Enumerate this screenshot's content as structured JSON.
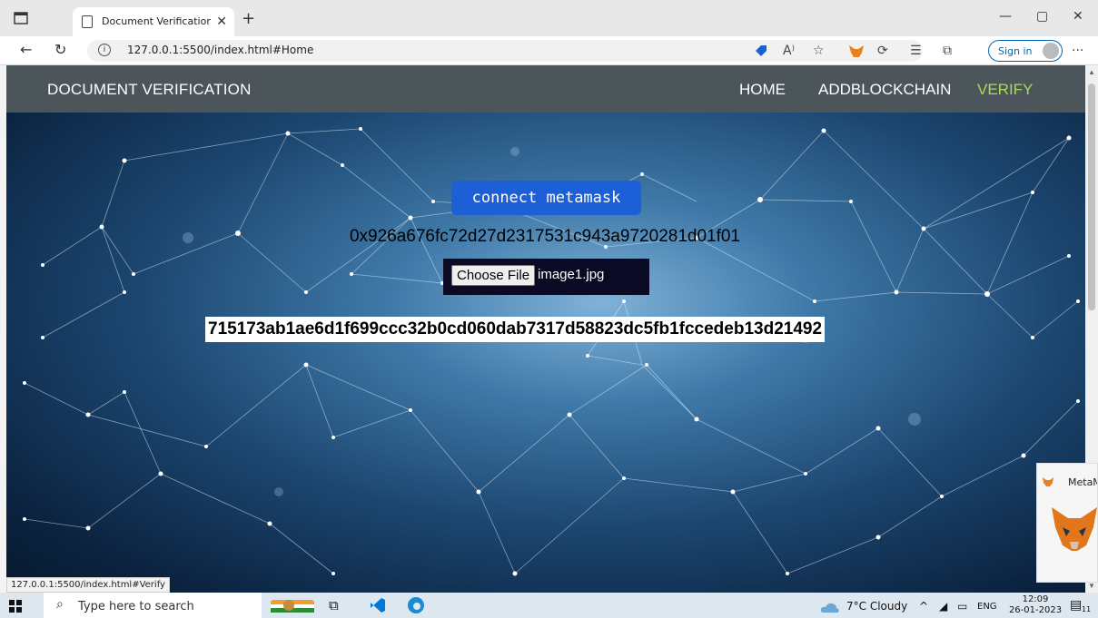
{
  "browser": {
    "tab_title": "Document Verification Using Blo",
    "tab_close": "✕",
    "new_tab": "+",
    "url": "127.0.0.1:5500/index.html#Home",
    "sign_in": "Sign in",
    "more": "···",
    "status_url": "127.0.0.1:5500/index.html#Verify"
  },
  "navbar": {
    "brand": "DOCUMENT VERIFICATION",
    "links": [
      {
        "label": "HOME",
        "active": false
      },
      {
        "label": "ADDBLOCKCHAIN",
        "active": false
      },
      {
        "label": "VERIFY",
        "active": true
      }
    ]
  },
  "main": {
    "connect_button": "connect metamask",
    "account_address": "0x926a676fc72d27d2317531c943a9720281d01f01",
    "choose_file_button": "Choose File",
    "file_name": "image1.jpg",
    "document_hash": "715173ab1ae6d1f699ccc32b0cd060dab7317d58823dc5fb1fccedeb13d21492"
  },
  "metamask_popup": {
    "label": "MetaM"
  },
  "taskbar": {
    "search_placeholder": "Type here to search",
    "weather": "7°C  Cloudy",
    "language": "ENG",
    "time": "12:09",
    "date": "26-01-2023",
    "notification_count": "11"
  },
  "colors": {
    "navbar_bg": "#4c5559",
    "active_link": "#a8dd5a",
    "connect_button": "#1c5fd6",
    "file_box_bg": "#0a0a24"
  }
}
